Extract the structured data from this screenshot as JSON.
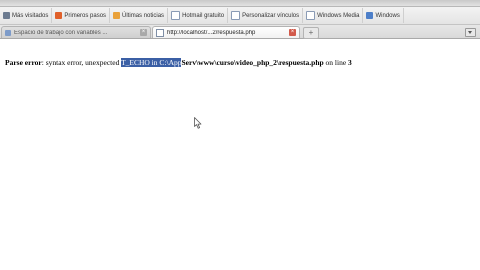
{
  "bookmarks": [
    {
      "label": "Más visitados",
      "icon": "gear-icon"
    },
    {
      "label": "Primeros pasos",
      "icon": "firefox-icon"
    },
    {
      "label": "Últimas noticias",
      "icon": "rss-icon"
    },
    {
      "label": "Hotmail gratuito",
      "icon": "page-icon"
    },
    {
      "label": "Personalizar vínculos",
      "icon": "page-icon"
    },
    {
      "label": "Windows Media",
      "icon": "page-icon"
    },
    {
      "label": "Windows",
      "icon": "windows-icon"
    }
  ],
  "tabs": [
    {
      "title": "Espacio de trabajo con variables ...",
      "active": false
    },
    {
      "title": "http://localhost/...2/respuesta.php",
      "active": true
    }
  ],
  "newtab_label": "+",
  "error": {
    "label": "Parse error",
    "colon": ":",
    "prefix": " syntax error, unexpected ",
    "selected": "T_ECHO in C:\\App",
    "rest": "Serv\\www\\curso\\video_php_2\\respuesta.php",
    "on_line": " on line ",
    "line_number": "3"
  }
}
